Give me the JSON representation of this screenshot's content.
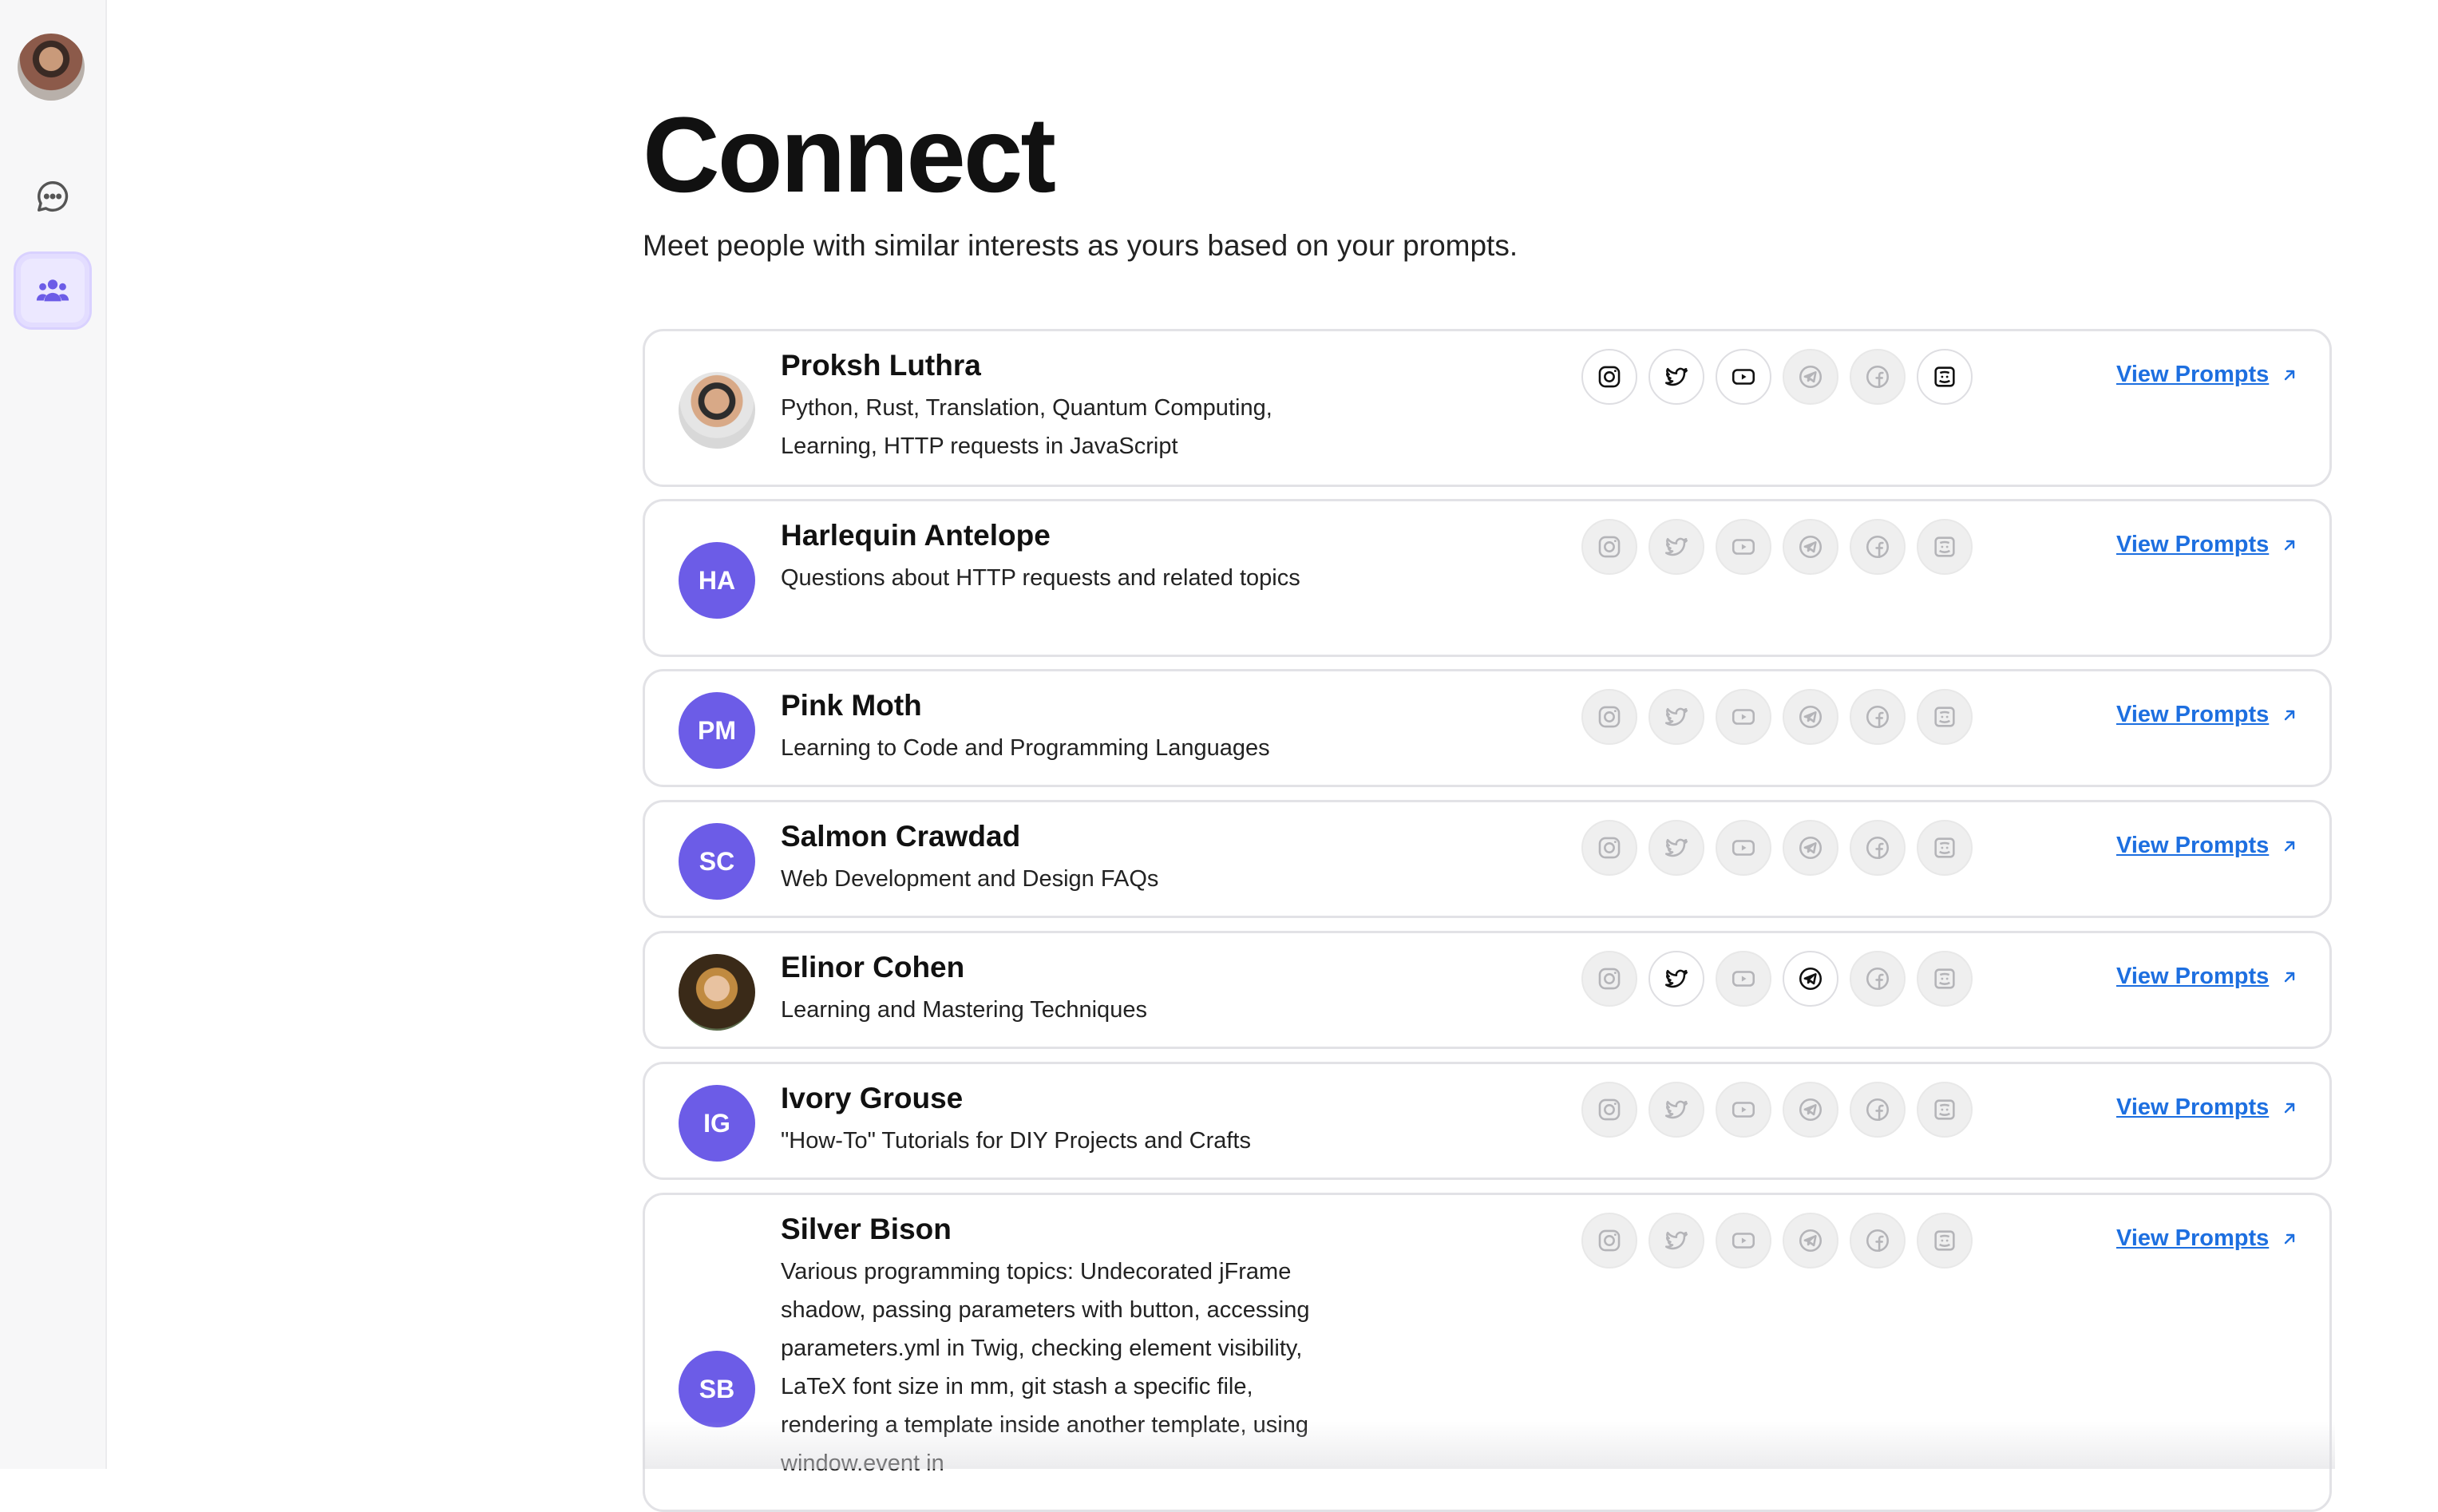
{
  "page": {
    "title": "Connect",
    "subtitle": "Meet people with similar interests as yours based on your prompts."
  },
  "colors": {
    "accent": "#6c5ce7",
    "link": "#1d6fe0",
    "active_nav_bg": "#ece8ff"
  },
  "sidebar": {
    "items": [
      {
        "name": "chat",
        "icon": "chat-bubble-icon",
        "active": false
      },
      {
        "name": "connect",
        "icon": "people-icon",
        "active": true
      }
    ]
  },
  "social_icons": [
    "instagram-icon",
    "twitter-icon",
    "youtube-icon",
    "telegram-icon",
    "facebook-icon",
    "discord-icon"
  ],
  "people": [
    {
      "name": "Proksh Luthra",
      "initials": "",
      "avatar": "photo",
      "description": "Python, Rust, Translation, Quantum Computing, Learning, HTTP requests in JavaScript",
      "socials_active": [
        true,
        true,
        true,
        false,
        false,
        true
      ],
      "link_label": "View Prompts"
    },
    {
      "name": "Harlequin Antelope",
      "initials": "HA",
      "avatar": "initials",
      "description": "Questions about HTTP requests and related topics",
      "socials_active": [
        false,
        false,
        false,
        false,
        false,
        false
      ],
      "link_label": "View Prompts"
    },
    {
      "name": "Pink Moth",
      "initials": "PM",
      "avatar": "initials",
      "description": "Learning to Code and Programming Languages",
      "socials_active": [
        false,
        false,
        false,
        false,
        false,
        false
      ],
      "link_label": "View Prompts"
    },
    {
      "name": "Salmon Crawdad",
      "initials": "SC",
      "avatar": "initials",
      "description": "Web Development and Design FAQs",
      "socials_active": [
        false,
        false,
        false,
        false,
        false,
        false
      ],
      "link_label": "View Prompts"
    },
    {
      "name": "Elinor Cohen",
      "initials": "",
      "avatar": "photo",
      "description": "Learning and Mastering Techniques",
      "socials_active": [
        false,
        true,
        false,
        true,
        false,
        false
      ],
      "link_label": "View Prompts"
    },
    {
      "name": "Ivory Grouse",
      "initials": "IG",
      "avatar": "initials",
      "description": "\"How-To\" Tutorials for DIY Projects and Crafts",
      "socials_active": [
        false,
        false,
        false,
        false,
        false,
        false
      ],
      "link_label": "View Prompts"
    },
    {
      "name": "Silver Bison",
      "initials": "SB",
      "avatar": "initials",
      "description": "Various programming topics: Undecorated jFrame shadow, passing parameters with button, accessing parameters.yml in Twig, checking element visibility, LaTeX font size in mm, git stash a specific file, rendering a template inside another template, using window.event in",
      "socials_active": [
        false,
        false,
        false,
        false,
        false,
        false
      ],
      "link_label": "View Prompts"
    }
  ]
}
